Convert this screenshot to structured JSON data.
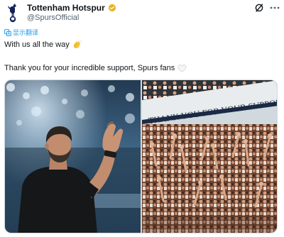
{
  "account": {
    "display_name": "Tottenham Hotspur",
    "handle": "@SpursOfficial"
  },
  "translate": {
    "label": "显示翻译"
  },
  "tweet": {
    "line1": "With us all the way",
    "line1_emoji": "clapping-hands",
    "line2": "Thank you for your incredible support, Spurs fans",
    "line2_emoji": "white-heart"
  },
  "media": {
    "banner_text": "THANK YOU FOR YOUR SUPPORT"
  },
  "colors": {
    "link": "#1d9bf0",
    "verified": "#e8b01c",
    "muted": "#536471"
  }
}
